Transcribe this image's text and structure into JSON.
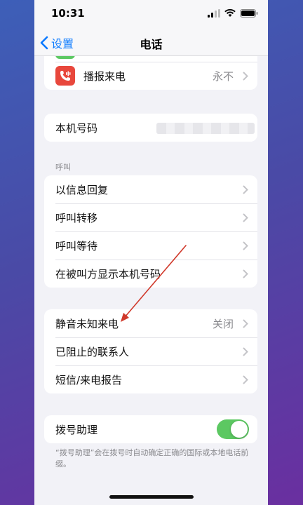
{
  "status": {
    "time": "10:31"
  },
  "nav": {
    "back_label": "设置",
    "title": "电话"
  },
  "group_top": {
    "announce_calls": {
      "label": "播报来电",
      "value": "永不"
    }
  },
  "my_number": {
    "label": "本机号码"
  },
  "calls_section": {
    "header": "呼叫",
    "items": [
      {
        "label": "以信息回复"
      },
      {
        "label": "呼叫转移"
      },
      {
        "label": "呼叫等待"
      },
      {
        "label": "在被叫方显示本机号码"
      }
    ]
  },
  "block_section": {
    "items": [
      {
        "label": "静音未知来电",
        "value": "关闭"
      },
      {
        "label": "已阻止的联系人"
      },
      {
        "label": "短信/来电报告"
      }
    ]
  },
  "dial_assist": {
    "label": "拨号助理",
    "enabled": true,
    "note": "“拨号助理”会在拨号时自动确定正确的国际或本地电话前缀。"
  },
  "colors": {
    "accent": "#0a7aff",
    "toggle_on": "#5cc862",
    "annotation_arrow": "#d0392b"
  }
}
